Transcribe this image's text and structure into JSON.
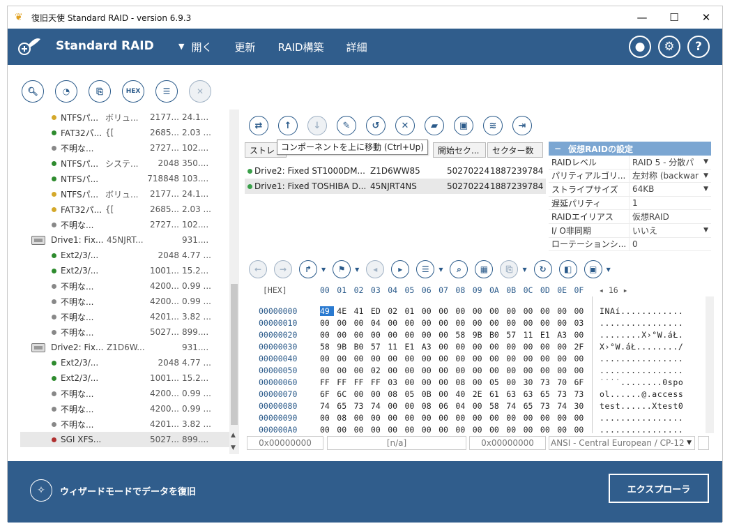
{
  "window": {
    "title": "復旧天使 Standard RAID - version 6.9.3"
  },
  "header": {
    "brand": "Standard RAID",
    "menu": [
      "開く",
      "更新",
      "RAID構築",
      "詳細"
    ]
  },
  "tree": {
    "rows": [
      {
        "type": "part",
        "dot": "#d4a82a",
        "name": "NTFSパ...",
        "label": "ボリュ...",
        "s1": "2177...",
        "s2": "24.1..."
      },
      {
        "type": "part",
        "dot": "#2e8b2e",
        "name": "FAT32パ...",
        "label": "{[",
        "s1": "2685...",
        "s2": "2.03 ..."
      },
      {
        "type": "part",
        "dot": "#888888",
        "name": "不明な...",
        "label": "",
        "s1": "2727...",
        "s2": "102...."
      },
      {
        "type": "part",
        "dot": "#2e8b2e",
        "name": "NTFSパ...",
        "label": "システ...",
        "s1": "2048",
        "s2": "350...."
      },
      {
        "type": "part",
        "dot": "#2e8b2e",
        "name": "NTFSパ...",
        "label": "",
        "s1": "718848",
        "s2": "103...."
      },
      {
        "type": "part",
        "dot": "#d4a82a",
        "name": "NTFSパ...",
        "label": "ボリュ...",
        "s1": "2177...",
        "s2": "24.1..."
      },
      {
        "type": "part",
        "dot": "#d4a82a",
        "name": "FAT32パ...",
        "label": "{[",
        "s1": "2685...",
        "s2": "2.03 ..."
      },
      {
        "type": "part",
        "dot": "#888888",
        "name": "不明な...",
        "label": "",
        "s1": "2727...",
        "s2": "102...."
      },
      {
        "type": "drive",
        "name": "Drive1: Fix...",
        "label": "45NJRT...",
        "s1": "",
        "s2": "931...."
      },
      {
        "type": "part",
        "dot": "#2e8b2e",
        "name": "Ext2/3/...",
        "label": "",
        "s1": "2048",
        "s2": "4.77 ..."
      },
      {
        "type": "part",
        "dot": "#2e8b2e",
        "name": "Ext2/3/...",
        "label": "",
        "s1": "1001...",
        "s2": "15.2..."
      },
      {
        "type": "part",
        "dot": "#888888",
        "name": "不明な...",
        "label": "",
        "s1": "4200...",
        "s2": "0.99 ..."
      },
      {
        "type": "part",
        "dot": "#888888",
        "name": "不明な...",
        "label": "",
        "s1": "4200...",
        "s2": "0.99 ..."
      },
      {
        "type": "part",
        "dot": "#888888",
        "name": "不明な...",
        "label": "",
        "s1": "4201...",
        "s2": "3.82 ..."
      },
      {
        "type": "part",
        "dot": "#888888",
        "name": "不明な...",
        "label": "",
        "s1": "5027...",
        "s2": "899...."
      },
      {
        "type": "drive",
        "name": "Drive2: Fix...",
        "label": "Z1D6W...",
        "s1": "",
        "s2": "931...."
      },
      {
        "type": "part",
        "dot": "#2e8b2e",
        "name": "Ext2/3/...",
        "label": "",
        "s1": "2048",
        "s2": "4.77 ..."
      },
      {
        "type": "part",
        "dot": "#2e8b2e",
        "name": "Ext2/3/...",
        "label": "",
        "s1": "1001...",
        "s2": "15.2..."
      },
      {
        "type": "part",
        "dot": "#888888",
        "name": "不明な...",
        "label": "",
        "s1": "4200...",
        "s2": "0.99 ..."
      },
      {
        "type": "part",
        "dot": "#888888",
        "name": "不明な...",
        "label": "",
        "s1": "4200...",
        "s2": "0.99 ..."
      },
      {
        "type": "part",
        "dot": "#888888",
        "name": "不明な...",
        "label": "",
        "s1": "4201...",
        "s2": "3.82 ..."
      },
      {
        "type": "part",
        "dot": "#b03030",
        "name": "SGI XFS...",
        "label": "",
        "s1": "5027...",
        "s2": "899....",
        "selected": true
      }
    ]
  },
  "components": {
    "headers": [
      "ストレ",
      "開始セク...",
      "セクター数"
    ],
    "tooltip": "コンポーネントを上に移動 (Ctrl+Up)",
    "rows": [
      {
        "name": "Drive2: Fixed ST1000DM...",
        "serial": "Z1D6WW85",
        "start": "50270224",
        "count": "1887239784"
      },
      {
        "name": "Drive1: Fixed TOSHIBA D...",
        "serial": "45NJRT4NS",
        "start": "50270224",
        "count": "1887239784",
        "selected": true
      }
    ]
  },
  "settings": {
    "title": "仮想RAIDの設定",
    "toggle": "−",
    "rows": [
      {
        "key": "RAIDレベル",
        "value": "RAID 5 - 分散パ",
        "dropdown": true
      },
      {
        "key": "パリティアルゴリ...",
        "value": "左対称 (backwar",
        "dropdown": true
      },
      {
        "key": "ストライプサイズ",
        "value": "64KB",
        "dropdown": true
      },
      {
        "key": "遅延パリティ",
        "value": "1",
        "dropdown": false
      },
      {
        "key": "RAIDエイリアス",
        "value": "仮想RAID",
        "dropdown": false
      },
      {
        "key": "I/ O非同期",
        "value": "いいえ",
        "dropdown": true
      },
      {
        "key": "ローテーションシ...",
        "value": "0",
        "dropdown": false
      }
    ]
  },
  "hex": {
    "label": "[HEX]",
    "columns": [
      "00",
      "01",
      "02",
      "03",
      "04",
      "05",
      "06",
      "07",
      "08",
      "09",
      "0A",
      "0B",
      "0C",
      "0D",
      "0E",
      "0F"
    ],
    "page": "16",
    "rows": [
      {
        "off": "00000000",
        "bytes": [
          "49",
          "4E",
          "41",
          "ED",
          "02",
          "01",
          "00",
          "00",
          "00",
          "00",
          "00",
          "00",
          "00",
          "00",
          "00",
          "00"
        ],
        "text": "INAí............"
      },
      {
        "off": "00000010",
        "bytes": [
          "00",
          "00",
          "00",
          "04",
          "00",
          "00",
          "00",
          "00",
          "00",
          "00",
          "00",
          "00",
          "00",
          "00",
          "00",
          "03"
        ],
        "text": "................"
      },
      {
        "off": "00000020",
        "bytes": [
          "00",
          "00",
          "00",
          "00",
          "00",
          "00",
          "00",
          "00",
          "58",
          "9B",
          "B0",
          "57",
          "11",
          "E1",
          "A3",
          "00"
        ],
        "text": "........X›°W.áŁ."
      },
      {
        "off": "00000030",
        "bytes": [
          "58",
          "9B",
          "B0",
          "57",
          "11",
          "E1",
          "A3",
          "00",
          "00",
          "00",
          "00",
          "00",
          "00",
          "00",
          "00",
          "2F"
        ],
        "text": "X›°W.áŁ......../"
      },
      {
        "off": "00000040",
        "bytes": [
          "00",
          "00",
          "00",
          "00",
          "00",
          "00",
          "00",
          "00",
          "00",
          "00",
          "00",
          "00",
          "00",
          "00",
          "00",
          "00"
        ],
        "text": "................"
      },
      {
        "off": "00000050",
        "bytes": [
          "00",
          "00",
          "00",
          "02",
          "00",
          "00",
          "00",
          "00",
          "00",
          "00",
          "00",
          "00",
          "00",
          "00",
          "00",
          "00"
        ],
        "text": "................"
      },
      {
        "off": "00000060",
        "bytes": [
          "FF",
          "FF",
          "FF",
          "FF",
          "03",
          "00",
          "00",
          "00",
          "08",
          "00",
          "05",
          "00",
          "30",
          "73",
          "70",
          "6F"
        ],
        "text": "˙˙˙˙........0spo"
      },
      {
        "off": "00000070",
        "bytes": [
          "6F",
          "6C",
          "00",
          "00",
          "08",
          "05",
          "0B",
          "00",
          "40",
          "2E",
          "61",
          "63",
          "63",
          "65",
          "73",
          "73"
        ],
        "text": "ol......@.access"
      },
      {
        "off": "00000080",
        "bytes": [
          "74",
          "65",
          "73",
          "74",
          "00",
          "00",
          "08",
          "06",
          "04",
          "00",
          "58",
          "74",
          "65",
          "73",
          "74",
          "30"
        ],
        "text": "test......Xtest0"
      },
      {
        "off": "00000090",
        "bytes": [
          "00",
          "08",
          "00",
          "00",
          "00",
          "00",
          "00",
          "00",
          "00",
          "00",
          "00",
          "00",
          "00",
          "00",
          "00",
          "00"
        ],
        "text": "................"
      },
      {
        "off": "000000A0",
        "bytes": [
          "00",
          "00",
          "00",
          "00",
          "00",
          "00",
          "00",
          "00",
          "00",
          "00",
          "00",
          "00",
          "00",
          "00",
          "00",
          "00"
        ],
        "text": "................"
      }
    ]
  },
  "status": {
    "offset": "0x00000000",
    "na": "[n/a]",
    "value": "0x00000000",
    "encoding": "ANSI - Central European / CP-12"
  },
  "footer": {
    "wizard": "ウィザードモードでデータを復旧",
    "explorer": "エクスプローラ"
  }
}
